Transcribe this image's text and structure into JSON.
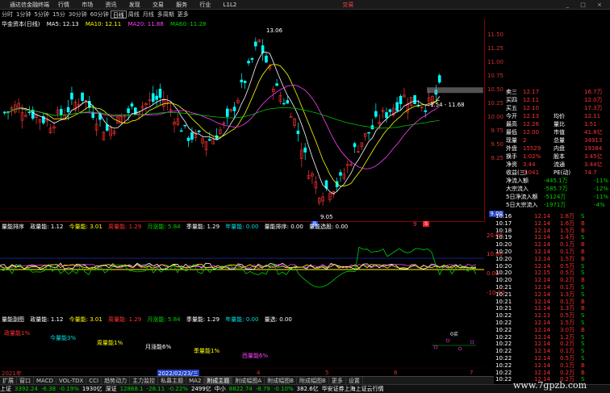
{
  "titlebar": {
    "app": "通达信金融终端",
    "menus": [
      "行情",
      "市场",
      "资讯",
      "发现",
      "交易",
      "服务",
      "行业",
      "L1L2"
    ],
    "brand": "交易",
    "window_controls": "_ □ ×"
  },
  "periods": {
    "items": [
      "分时",
      "1分钟",
      "5分钟",
      "15分",
      "30分钟",
      "60分钟",
      "日线",
      "周线",
      "月线",
      "多周期",
      "更多"
    ],
    "active_index": 6
  },
  "main": {
    "stock": "华金资本(日线)",
    "ma_label": "MA5: 12.13",
    "ma10": "MA10: 12.11",
    "ma20": "MA20: 11.88",
    "ma60": "MA60: 11.28",
    "hi_label": "13.06",
    "lo_label": "9.05",
    "range_label": "1.54 - 11.68",
    "price_ticks": [
      "11.50",
      "11.25",
      "11.00",
      "10.75",
      "10.50",
      "10.25",
      "10.00",
      "9.75",
      "9.50",
      "9.25",
      "9.00"
    ],
    "marker_b": "B",
    "marker_s": "S",
    "marker_9": "9"
  },
  "quote": {
    "rows": [
      {
        "l": "卖三",
        "v": "12.17",
        "r": "16.7万"
      },
      {
        "l": "买四",
        "v": "12.11",
        "r": "12.0万"
      },
      {
        "l": "买五",
        "v": "12.10",
        "r": "17.3万"
      },
      {
        "l": "今开",
        "v": "12.13",
        "r2l": "均价",
        "r": "12.11"
      },
      {
        "l": "最高",
        "v": "12.26",
        "r2l": "量比",
        "r": "1.51"
      },
      {
        "l": "最低",
        "v": "12.00",
        "r2l": "市值",
        "r": "41.8亿"
      },
      {
        "l": "现量",
        "v": "2",
        "r2l": "总量",
        "r": "34913"
      },
      {
        "l": "外盘",
        "v": "15529",
        "r2l": "内盘",
        "r": "19384"
      },
      {
        "l": "换手",
        "v": "1.02%",
        "r2l": "股本",
        "r": "3.45亿"
      },
      {
        "l": "净资",
        "v": "3.44",
        "r2l": "流通",
        "r": "3.44亿"
      },
      {
        "l": "收益(三)",
        "v": "0.041",
        "r2l": "PE(动)",
        "r": "74.7"
      },
      {
        "l": "净流入额",
        "v": "-445.1万",
        "r": "-11%"
      },
      {
        "l": "大宗流入",
        "v": "-585.7万",
        "r": "-12%"
      },
      {
        "l": "5日净流入额",
        "v": "-5124万",
        "r": "-11%"
      },
      {
        "l": "5日大宗流入",
        "v": "-1971万",
        "r": "-4%"
      }
    ]
  },
  "ticks": [
    {
      "t": "10:16",
      "p": "12.14",
      "v": "1.8万",
      "d": "S"
    },
    {
      "t": "10:17",
      "p": "12.14",
      "v": "1.6万",
      "d": "B"
    },
    {
      "t": "10:18",
      "p": "12.14",
      "v": "1.5万",
      "d": "B"
    },
    {
      "t": "10:19",
      "p": "12.14",
      "v": "1.4万",
      "d": "S"
    },
    {
      "t": "10:20",
      "p": "12.14",
      "v": "0.1万",
      "d": "B"
    },
    {
      "t": "10:20",
      "p": "12.14",
      "v": "0.1万",
      "d": "B"
    },
    {
      "t": "10:20",
      "p": "12.14",
      "v": "1.5万",
      "d": "B"
    },
    {
      "t": "10:20",
      "p": "12.14",
      "v": "0.5万",
      "d": "S"
    },
    {
      "t": "10:20",
      "p": "12.15",
      "v": "0.5万",
      "d": "S"
    },
    {
      "t": "10:20",
      "p": "12.14",
      "v": "0.2万",
      "d": "B"
    },
    {
      "t": "10:21",
      "p": "12.14",
      "v": "0.1万",
      "d": "S"
    },
    {
      "t": "10:21",
      "p": "12.14",
      "v": "1.3万",
      "d": "S"
    },
    {
      "t": "10:21",
      "p": "12.14",
      "v": "0.1万",
      "d": "B"
    },
    {
      "t": "10:21",
      "p": "12.14",
      "v": "1.3万",
      "d": "B"
    },
    {
      "t": "10:22",
      "p": "12.13",
      "v": "0.5万",
      "d": "S"
    },
    {
      "t": "10:22",
      "p": "12.14",
      "v": "1.5万",
      "d": "S"
    },
    {
      "t": "10:22",
      "p": "12.14",
      "v": "3.0万",
      "d": "B"
    },
    {
      "t": "10:22",
      "p": "12.14",
      "v": "1.2万",
      "d": "S"
    },
    {
      "t": "10:22",
      "p": "12.14",
      "v": "0.2万",
      "d": "S"
    },
    {
      "t": "10:22",
      "p": "12.14",
      "v": "0.1万",
      "d": "S"
    },
    {
      "t": "10:22",
      "p": "12.14",
      "v": "0.5万",
      "d": "S"
    },
    {
      "t": "10:22",
      "p": "12.14",
      "v": "0.1万",
      "d": "B"
    },
    {
      "t": "10:22",
      "p": "12.14",
      "v": "0.2万",
      "d": "B"
    },
    {
      "t": "10:22",
      "p": "12.14",
      "v": "0.2万",
      "d": "S"
    },
    {
      "t": "10:22",
      "p": "12.14",
      "v": "1.4万",
      "d": "B"
    }
  ],
  "sub1": {
    "name": "量能排序",
    "items": [
      {
        "text": "政量能: 1.12",
        "c": "white"
      },
      {
        "text": "今量能: 3.01",
        "c": "yellow"
      },
      {
        "text": "周量能: 1.29",
        "c": "red"
      },
      {
        "text": "月涨能: 5.84",
        "c": "green"
      },
      {
        "text": "季量能: 1.29",
        "c": "white"
      },
      {
        "text": "年量能: 0.00",
        "c": "cyan"
      },
      {
        "text": "量能排序: 0.00",
        "c": "white"
      },
      {
        "text": "量能选股: 0.00",
        "c": "white"
      }
    ],
    "axis": [
      "20.00",
      "10.00",
      "0.00",
      "-10.00"
    ]
  },
  "sub2": {
    "name": "量能副图",
    "items": [
      {
        "text": "政量能: 1.12",
        "c": "white"
      },
      {
        "text": "今量能: 3.01",
        "c": "yellow"
      },
      {
        "text": "周量能: 1.29",
        "c": "red"
      },
      {
        "text": "月涨能: 5.84",
        "c": "green"
      },
      {
        "text": "季量能: 1.29",
        "c": "white"
      },
      {
        "text": "年量能: 0.00",
        "c": "cyan"
      },
      {
        "text": "量选: 0.00",
        "c": "white"
      }
    ],
    "labels": [
      {
        "text": "政量能1%",
        "c": "red"
      },
      {
        "text": "今量能3%",
        "c": "cyan"
      },
      {
        "text": "周量能1%",
        "c": "yellow"
      },
      {
        "text": "月涨能6%",
        "c": "white"
      },
      {
        "text": "季量能1%",
        "c": "yellow"
      },
      {
        "text": "西量能6%",
        "c": "mag"
      }
    ],
    "mini": "0买"
  },
  "timeaxis": {
    "left": "2021年",
    "date": "2022/02/23/三",
    "marks": [
      "4",
      "5",
      "6",
      "7"
    ]
  },
  "tabs": [
    "扩展",
    "窗口",
    "MACD",
    "VOL-TDX",
    "CCI",
    "趋势动力",
    "主力监控",
    "私募主题",
    "MA2",
    "附成主题",
    "附成幅图A",
    "附成幅图B",
    "附成幅图B",
    "更多",
    "设置"
  ],
  "tabs_active": 9,
  "tabs2": [
    "关联报价",
    "资金分布",
    "综合资讯",
    "行业资讯",
    "互动问答",
    "所有产品利专享"
  ],
  "status": {
    "sh_label": "上证",
    "sh_val": "3392.24",
    "sh_chg": "-6.38",
    "sh_pct": "-0.19%",
    "sh_amt": "1930亿",
    "sz_label": "深证",
    "sz_val": "12868.1",
    "sz_chg": "-28.11",
    "sz_pct": "-0.22%",
    "sz_amt": "2499亿",
    "cy_label": "中小",
    "cy_val": "8822.74",
    "cy_chg": "-8.79",
    "cy_pct": "-0.10%",
    "cy_amt": "382.6亿",
    "msg": "华安证券上海上证云行情"
  },
  "watermark": "www.7gpzb.com"
}
